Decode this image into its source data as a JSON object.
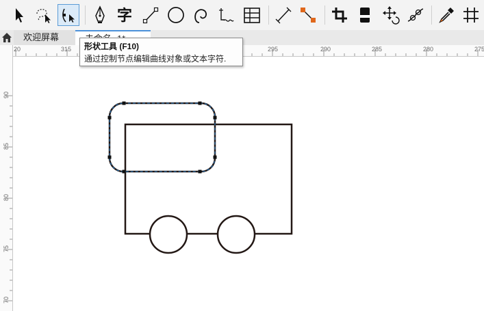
{
  "toolbar": {
    "tools": [
      {
        "icon": "pick-tool-icon"
      },
      {
        "icon": "freehand-pick-tool-icon"
      },
      {
        "icon": "shape-tool-icon",
        "active": true
      },
      {
        "icon": "pen-tool-icon"
      },
      {
        "icon": "text-tool-icon",
        "glyph": "字"
      },
      {
        "icon": "line-tool-icon"
      },
      {
        "icon": "ellipse-tool-icon"
      },
      {
        "icon": "spiral-tool-icon"
      },
      {
        "icon": "dimension-tool-icon"
      },
      {
        "icon": "table-tool-icon"
      },
      {
        "icon": "parallel-dimension-tool-icon"
      },
      {
        "icon": "connector-tool-icon"
      },
      {
        "icon": "crop-tool-icon"
      },
      {
        "icon": "eraser-tool-icon"
      },
      {
        "icon": "transform-tool-icon"
      },
      {
        "icon": "smudge-tool-icon"
      },
      {
        "icon": "eyedropper-tool-icon"
      },
      {
        "icon": "grid-tool-icon"
      }
    ]
  },
  "tabs": {
    "welcome": "欢迎屏幕",
    "document": "未命名 -1*"
  },
  "tooltip": {
    "title": "形状工具 (F10)",
    "description": "通过控制节点编辑曲线对象或文本字符."
  },
  "ruler": {
    "horizontal": [
      "20",
      "315",
      "295",
      "290",
      "285",
      "280",
      "275"
    ],
    "vertical": [
      "90",
      "85",
      "80",
      "75",
      "70"
    ]
  },
  "colors": {
    "accent": "#4a90d9",
    "selection_outline": "#2a7fc9",
    "shape_stroke": "#231815"
  }
}
